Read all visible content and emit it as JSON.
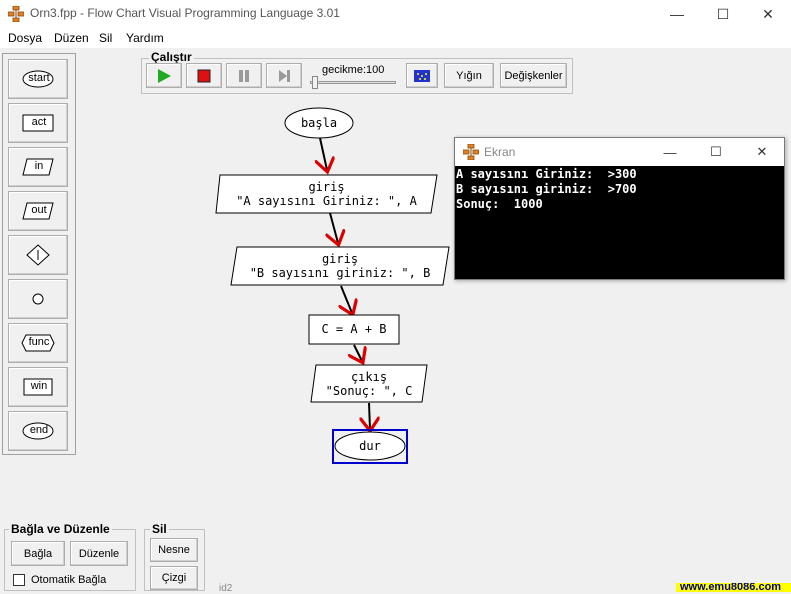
{
  "window": {
    "title": "Orn3.fpp - Flow Chart Visual Programming Language 3.01",
    "controls": {
      "minimize": "—",
      "maximize": "☐",
      "close": "✕"
    }
  },
  "menu": [
    "Dosya",
    "Düzen",
    "Sil",
    "Yardım"
  ],
  "palette": [
    "start",
    "act",
    "in",
    "out",
    "",
    "",
    "func",
    "win",
    "end"
  ],
  "toolbar": {
    "group_label": "Çalıştır",
    "delay_label": "gecikme:100",
    "stack_label": "Yığın",
    "vars_label": "Değişkenler",
    "colors": {
      "play": "#22aa22",
      "stop": "#dd1111"
    }
  },
  "flowchart": {
    "start": "başla",
    "input1": {
      "keyword": "giriş",
      "text": "\"A sayısını Giriniz: \", A"
    },
    "input2": {
      "keyword": "giriş",
      "text": "\"B sayısını giriniz: \", B"
    },
    "process": "C = A + B",
    "output": {
      "keyword": "çıkış",
      "text": "\"Sonuç: \", C"
    },
    "end": "dur",
    "colors": {
      "arrow": "#dd0000",
      "selection": "#0000cc"
    }
  },
  "ekran": {
    "title": "Ekran",
    "lines": [
      "A sayısını Giriniz:  >300",
      "B sayısını giriniz:  >700",
      "Sonuç:  1000"
    ]
  },
  "bagla": {
    "group_label": "Bağla ve Düzenle",
    "connect": "Bağla",
    "arrange": "Düzenle",
    "auto_label": "Otomatik Bağla",
    "auto_checked": false
  },
  "sil": {
    "group_label": "Sil",
    "object": "Nesne",
    "line": "Çizgi"
  },
  "status": {
    "id_text": "id2",
    "link": "www.emu8086.com"
  }
}
